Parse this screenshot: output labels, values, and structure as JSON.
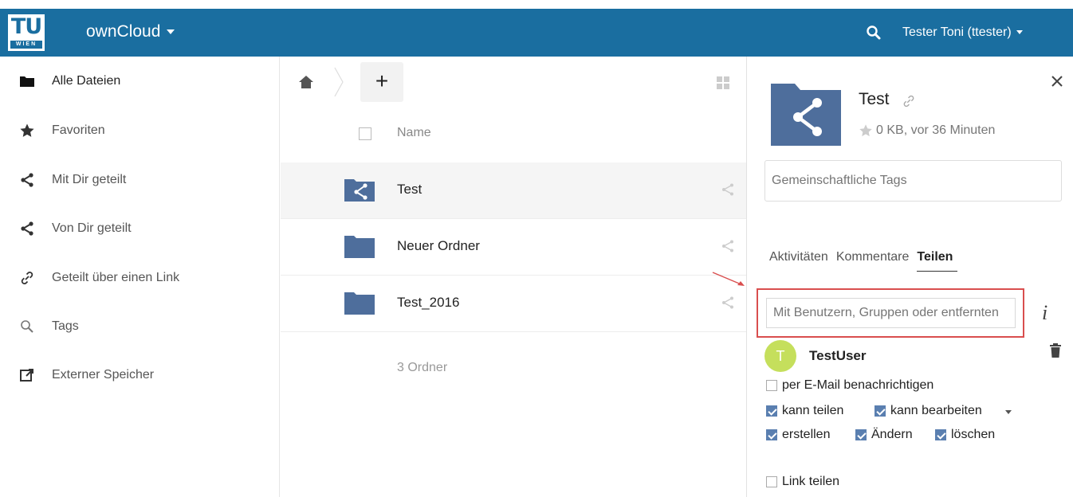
{
  "header": {
    "logo_main": "TU",
    "logo_sub": "WIEN",
    "app_name": "ownCloud",
    "user_name": "Tester Toni (ttester)"
  },
  "sidebar": {
    "items": [
      {
        "label": "Alle Dateien",
        "icon": "folder-icon"
      },
      {
        "label": "Favoriten",
        "icon": "star-icon"
      },
      {
        "label": "Mit Dir geteilt",
        "icon": "share-icon"
      },
      {
        "label": "Von Dir geteilt",
        "icon": "share-icon"
      },
      {
        "label": "Geteilt über einen Link",
        "icon": "link-icon"
      },
      {
        "label": "Tags",
        "icon": "search-icon"
      },
      {
        "label": "Externer Speicher",
        "icon": "external-storage-icon"
      }
    ]
  },
  "files": {
    "add_label": "+",
    "column_name": "Name",
    "rows": [
      {
        "name": "Test",
        "type": "shared-folder"
      },
      {
        "name": "Neuer Ordner",
        "type": "folder"
      },
      {
        "name": "Test_2016",
        "type": "folder"
      }
    ],
    "summary": "3 Ordner"
  },
  "details": {
    "title": "Test",
    "meta": "0 KB, vor 36 Minuten",
    "tags_placeholder": "Gemeinschaftliche Tags",
    "tabs": [
      "Aktivitäten",
      "Kommentare",
      "Teilen"
    ],
    "active_tab": "Teilen",
    "share_placeholder": "Mit Benutzern, Gruppen oder entfernten",
    "share_user_initial": "T",
    "share_user": "TestUser",
    "permissions": {
      "notify": "per E-Mail benachrichtigen",
      "can_share": "kann teilen",
      "can_edit": "kann bearbeiten",
      "create": "erstellen",
      "change": "Ändern",
      "delete": "löschen"
    },
    "link_share": "Link teilen"
  },
  "colors": {
    "header": "#1a6ea0",
    "folder": "#4e6e9c",
    "highlight": "#d94e4e",
    "avatar": "#c5df5c"
  }
}
